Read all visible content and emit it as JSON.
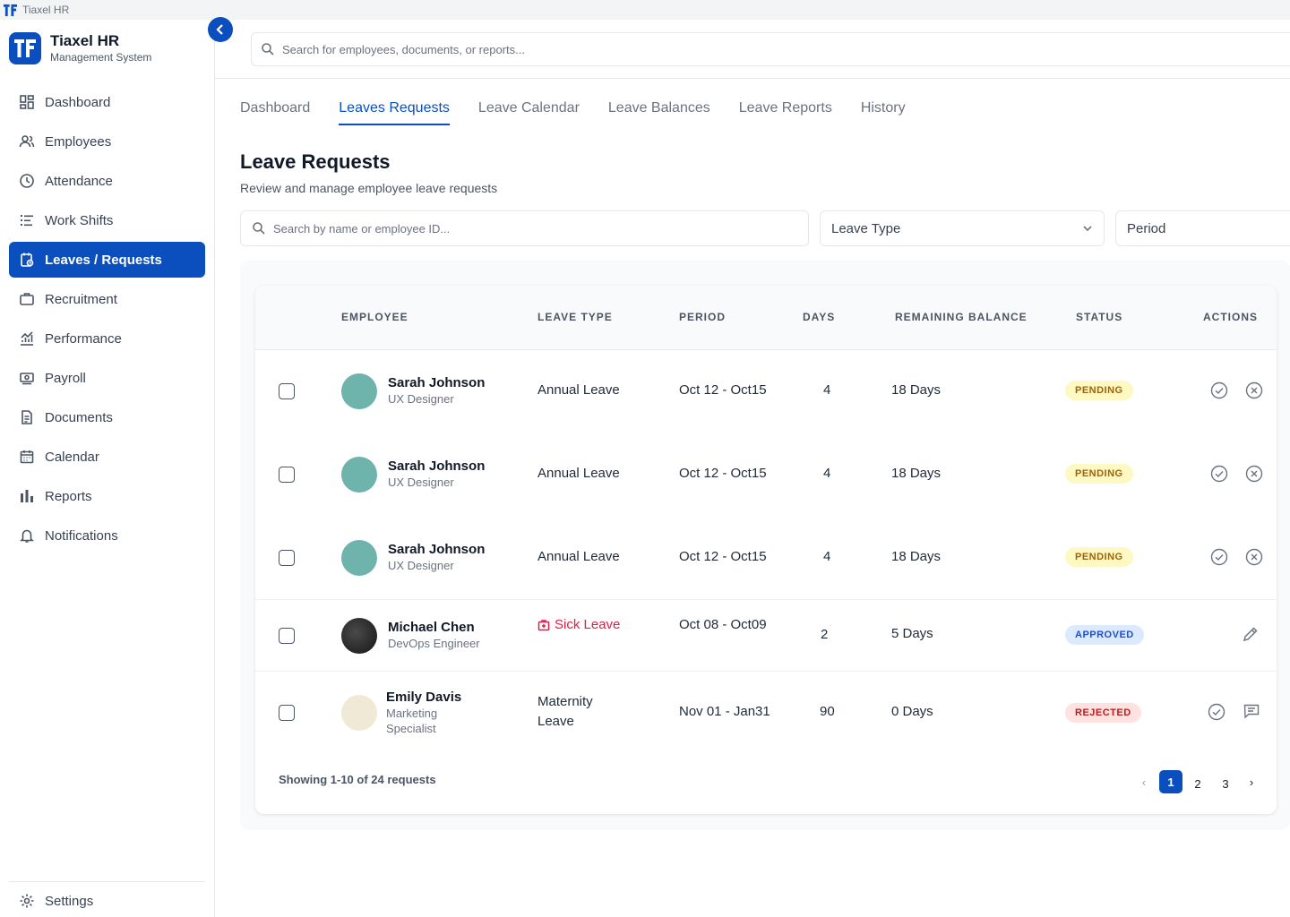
{
  "window": {
    "title": "Tiaxel HR"
  },
  "brand": {
    "name": "Tiaxel HR",
    "subtitle": "Management System"
  },
  "colors": {
    "accent": "#0b4fbf",
    "pending": "#fef9c3",
    "approved": "#dbeafe",
    "rejected": "#fee2e2",
    "sick": "#e11d48"
  },
  "sidebar": {
    "items": [
      {
        "label": "Dashboard",
        "icon": "dashboard-icon"
      },
      {
        "label": "Employees",
        "icon": "users-icon"
      },
      {
        "label": "Attendance",
        "icon": "clock-icon"
      },
      {
        "label": "Work Shifts",
        "icon": "list-icon"
      },
      {
        "label": "Leaves / Requests",
        "icon": "leave-icon",
        "active": true
      },
      {
        "label": "Recruitment",
        "icon": "briefcase-icon"
      },
      {
        "label": "Performance",
        "icon": "chart-icon"
      },
      {
        "label": "Payroll",
        "icon": "payroll-icon"
      },
      {
        "label": "Documents",
        "icon": "document-icon"
      },
      {
        "label": "Calendar",
        "icon": "calendar-icon"
      },
      {
        "label": "Reports",
        "icon": "bar-chart-icon"
      },
      {
        "label": "Notifications",
        "icon": "bell-icon"
      }
    ],
    "settings_label": "Settings"
  },
  "topbar": {
    "search_placeholder": "Search for employees, documents, or reports..."
  },
  "tabs": [
    {
      "label": "Dashboard"
    },
    {
      "label": "Leaves Requests",
      "active": true
    },
    {
      "label": "Leave Calendar"
    },
    {
      "label": "Leave Balances"
    },
    {
      "label": "Leave Reports"
    },
    {
      "label": "History"
    }
  ],
  "page": {
    "title": "Leave Requests",
    "subtitle": "Review and manage employee leave requests"
  },
  "filters": {
    "search_placeholder": "Search by name or employee ID...",
    "leave_type": "Leave Type",
    "period": "Period"
  },
  "table": {
    "headers": [
      "EMPLOYEE",
      "LEAVE TYPE",
      "PERIOD",
      "DAYS",
      "REMAINING BALANCE",
      "STATUS",
      "ACTIONS"
    ],
    "rows": [
      {
        "name": "Sarah Johnson",
        "role": "UX Designer",
        "avatar": "#6fb3ad",
        "leave_type": "Annual Leave",
        "period": "Oct 12 - Oct15",
        "days": "4",
        "balance": "18 Days",
        "status": "PENDING"
      },
      {
        "name": "Sarah Johnson",
        "role": "UX Designer",
        "avatar": "#6fb3ad",
        "leave_type": "Annual Leave",
        "period": "Oct 12 - Oct15",
        "days": "4",
        "balance": "18 Days",
        "status": "PENDING"
      },
      {
        "name": "Sarah Johnson",
        "role": "UX Designer",
        "avatar": "#6fb3ad",
        "leave_type": "Annual Leave",
        "period": "Oct 12 - Oct15",
        "days": "4",
        "balance": "18 Days",
        "status": "PENDING"
      },
      {
        "name": "Michael Chen",
        "role": "DevOps Engineer",
        "avatar": "#262626",
        "leave_type": "Sick Leave",
        "period": "Oct 08 - Oct09",
        "days": "2",
        "balance": "5 Days",
        "status": "APPROVED"
      },
      {
        "name": "Emily Davis",
        "role_line1": "Marketing",
        "role_line2": "Specialist",
        "avatar": "#f0e9d6",
        "leave_type_line1": "Maternity",
        "leave_type_line2": "Leave",
        "period": "Nov 01 - Jan31",
        "days": "90",
        "balance": "0 Days",
        "status": "REJECTED"
      }
    ]
  },
  "footer": {
    "showing": "Showing 1-10 of 24  requests"
  },
  "pagination": {
    "pages": [
      "1",
      "2",
      "3"
    ],
    "current": "1",
    "prev": "‹",
    "next": "›"
  }
}
